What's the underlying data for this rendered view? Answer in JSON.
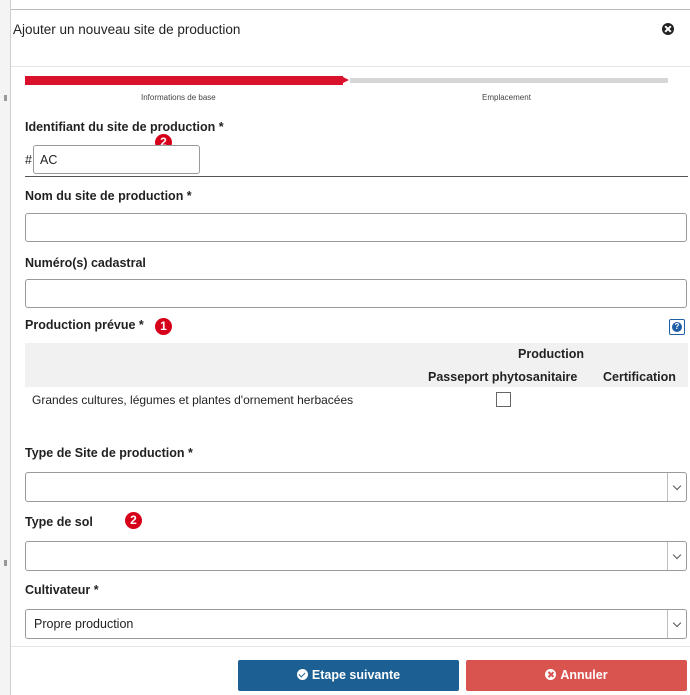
{
  "modal": {
    "title": "Ajouter un nouveau site de production"
  },
  "progress": {
    "steps": [
      "Informations de base",
      "Emplacement"
    ],
    "current_step": 1,
    "total_steps": 2,
    "active_color": "#d9112a"
  },
  "fields": {
    "site_id": {
      "label": "Identifiant du site de production *",
      "prefix": "#",
      "value": "AC"
    },
    "site_name": {
      "label": "Nom du site de production *",
      "value": ""
    },
    "cadastral": {
      "label": "Numéro(s) cadastral",
      "value": ""
    },
    "production": {
      "label": "Production prévue *",
      "table": {
        "group_header": "Production",
        "columns": [
          "Passeport phytosanitaire",
          "Certification"
        ],
        "rows": [
          {
            "label": "Grandes cultures, légumes et plantes d'ornement herbacées",
            "passeport_checked": false
          }
        ]
      }
    },
    "site_type": {
      "label": "Type de Site de production *",
      "value": ""
    },
    "soil_type": {
      "label": "Type de sol",
      "value": ""
    },
    "grower": {
      "label": "Cultivateur *",
      "value": "Propre production"
    }
  },
  "badges": {
    "one": "1",
    "two": "2"
  },
  "footer": {
    "next_label": "Etape suivante",
    "cancel_label": "Annuler",
    "next_color": "#1b5f93",
    "cancel_color": "#d9534f"
  }
}
